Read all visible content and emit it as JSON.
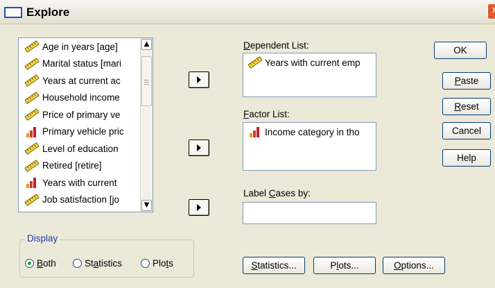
{
  "window": {
    "title": "Explore",
    "close_glyph": "✕"
  },
  "variables": [
    {
      "label": "Age in years [age]",
      "icon": "scale-icon"
    },
    {
      "label": "Marital status [mari",
      "icon": "scale-icon"
    },
    {
      "label": "Years at current ac",
      "icon": "scale-icon"
    },
    {
      "label": "Household income",
      "icon": "scale-icon"
    },
    {
      "label": "Price of primary ve",
      "icon": "scale-icon"
    },
    {
      "label": "Primary vehicle pric",
      "icon": "ordinal-icon"
    },
    {
      "label": "Level of education",
      "icon": "scale-icon"
    },
    {
      "label": "Retired [retire]",
      "icon": "scale-icon"
    },
    {
      "label": "Years with current",
      "icon": "ordinal-icon"
    },
    {
      "label": "Job satisfaction [jo",
      "icon": "scale-icon"
    }
  ],
  "scrollbar": {
    "up": "▲",
    "down": "▼"
  },
  "dependent": {
    "label_u": "D",
    "label_rest": "ependent List:",
    "items": [
      {
        "label": "Years with current emp",
        "icon": "scale-icon"
      }
    ]
  },
  "factor": {
    "label_u": "F",
    "label_rest": "actor List:",
    "items": [
      {
        "label": "Income category in tho",
        "icon": "ordinal-icon"
      }
    ]
  },
  "label_cases": {
    "pre": "Label ",
    "u": "C",
    "post": "ases by:",
    "value": ""
  },
  "side_buttons": {
    "ok": "OK",
    "paste_u": "P",
    "paste_rest": "aste",
    "reset_u": "R",
    "reset_rest": "eset",
    "cancel": "Cancel",
    "help": "Help"
  },
  "display": {
    "title": "Display",
    "both_u": "B",
    "both_rest": "oth",
    "stats_pre": "St",
    "stats_u": "a",
    "stats_post": "tistics",
    "plots_pre": "Plo",
    "plots_u": "t",
    "plots_post": "s",
    "selected": "Both"
  },
  "bottom_buttons": {
    "statistics_u": "S",
    "statistics_rest": "tatistics...",
    "plots_pre": "P",
    "plots_u": "l",
    "plots_post": "ots...",
    "options_u": "O",
    "options_rest": "ptions..."
  }
}
